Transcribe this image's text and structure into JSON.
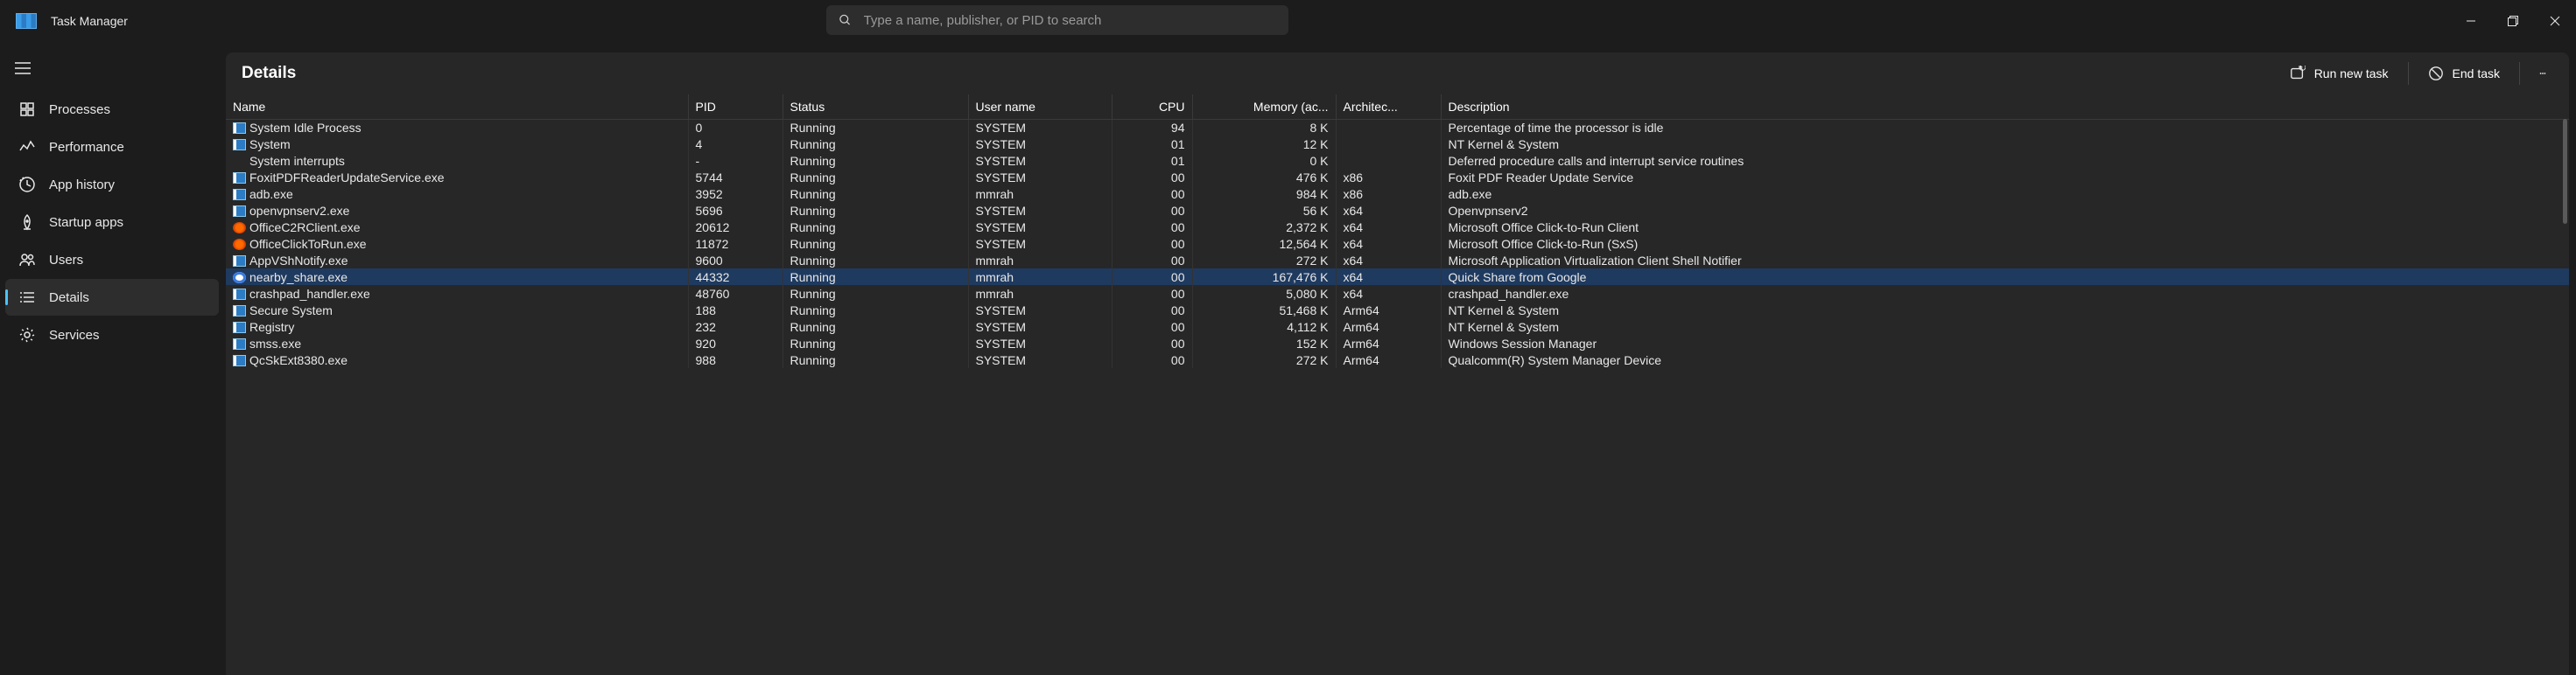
{
  "app": {
    "title": "Task Manager"
  },
  "search": {
    "placeholder": "Type a name, publisher, or PID to search"
  },
  "sidebar": {
    "items": [
      {
        "label": "Processes"
      },
      {
        "label": "Performance"
      },
      {
        "label": "App history"
      },
      {
        "label": "Startup apps"
      },
      {
        "label": "Users"
      },
      {
        "label": "Details"
      },
      {
        "label": "Services"
      }
    ]
  },
  "panel": {
    "title": "Details",
    "run_new_task": "Run new task",
    "end_task": "End task"
  },
  "columns": {
    "name": "Name",
    "pid": "PID",
    "status": "Status",
    "user": "User name",
    "cpu": "CPU",
    "memory": "Memory (ac...",
    "arch": "Architec...",
    "desc": "Description"
  },
  "rows": [
    {
      "icon": "default",
      "name": "System Idle Process",
      "pid": "0",
      "status": "Running",
      "user": "SYSTEM",
      "cpu": "94",
      "mem": "8 K",
      "arch": "",
      "desc": "Percentage of time the processor is idle"
    },
    {
      "icon": "default",
      "name": "System",
      "pid": "4",
      "status": "Running",
      "user": "SYSTEM",
      "cpu": "01",
      "mem": "12 K",
      "arch": "",
      "desc": "NT Kernel & System"
    },
    {
      "icon": "none",
      "name": "System interrupts",
      "pid": "-",
      "status": "Running",
      "user": "SYSTEM",
      "cpu": "01",
      "mem": "0 K",
      "arch": "",
      "desc": "Deferred procedure calls and interrupt service routines"
    },
    {
      "icon": "default",
      "name": "FoxitPDFReaderUpdateService.exe",
      "pid": "5744",
      "status": "Running",
      "user": "SYSTEM",
      "cpu": "00",
      "mem": "476 K",
      "arch": "x86",
      "desc": "Foxit PDF Reader Update Service"
    },
    {
      "icon": "default",
      "name": "adb.exe",
      "pid": "3952",
      "status": "Running",
      "user": "mmrah",
      "cpu": "00",
      "mem": "984 K",
      "arch": "x86",
      "desc": "adb.exe"
    },
    {
      "icon": "default",
      "name": "openvpnserv2.exe",
      "pid": "5696",
      "status": "Running",
      "user": "SYSTEM",
      "cpu": "00",
      "mem": "56 K",
      "arch": "x64",
      "desc": "Openvpnserv2"
    },
    {
      "icon": "office",
      "name": "OfficeC2RClient.exe",
      "pid": "20612",
      "status": "Running",
      "user": "SYSTEM",
      "cpu": "00",
      "mem": "2,372 K",
      "arch": "x64",
      "desc": "Microsoft Office Click-to-Run Client"
    },
    {
      "icon": "office",
      "name": "OfficeClickToRun.exe",
      "pid": "11872",
      "status": "Running",
      "user": "SYSTEM",
      "cpu": "00",
      "mem": "12,564 K",
      "arch": "x64",
      "desc": "Microsoft Office Click-to-Run (SxS)"
    },
    {
      "icon": "default",
      "name": "AppVShNotify.exe",
      "pid": "9600",
      "status": "Running",
      "user": "mmrah",
      "cpu": "00",
      "mem": "272 K",
      "arch": "x64",
      "desc": "Microsoft Application Virtualization Client Shell Notifier"
    },
    {
      "icon": "share",
      "name": "nearby_share.exe",
      "pid": "44332",
      "status": "Running",
      "user": "mmrah",
      "cpu": "00",
      "mem": "167,476 K",
      "arch": "x64",
      "desc": "Quick Share from Google",
      "selected": true
    },
    {
      "icon": "default",
      "name": "crashpad_handler.exe",
      "pid": "48760",
      "status": "Running",
      "user": "mmrah",
      "cpu": "00",
      "mem": "5,080 K",
      "arch": "x64",
      "desc": "crashpad_handler.exe"
    },
    {
      "icon": "default",
      "name": "Secure System",
      "pid": "188",
      "status": "Running",
      "user": "SYSTEM",
      "cpu": "00",
      "mem": "51,468 K",
      "arch": "Arm64",
      "desc": "NT Kernel & System"
    },
    {
      "icon": "default",
      "name": "Registry",
      "pid": "232",
      "status": "Running",
      "user": "SYSTEM",
      "cpu": "00",
      "mem": "4,112 K",
      "arch": "Arm64",
      "desc": "NT Kernel & System"
    },
    {
      "icon": "default",
      "name": "smss.exe",
      "pid": "920",
      "status": "Running",
      "user": "SYSTEM",
      "cpu": "00",
      "mem": "152 K",
      "arch": "Arm64",
      "desc": "Windows Session Manager"
    },
    {
      "icon": "default",
      "name": "QcSkExt8380.exe",
      "pid": "988",
      "status": "Running",
      "user": "SYSTEM",
      "cpu": "00",
      "mem": "272 K",
      "arch": "Arm64",
      "desc": "Qualcomm(R) System Manager Device"
    }
  ]
}
